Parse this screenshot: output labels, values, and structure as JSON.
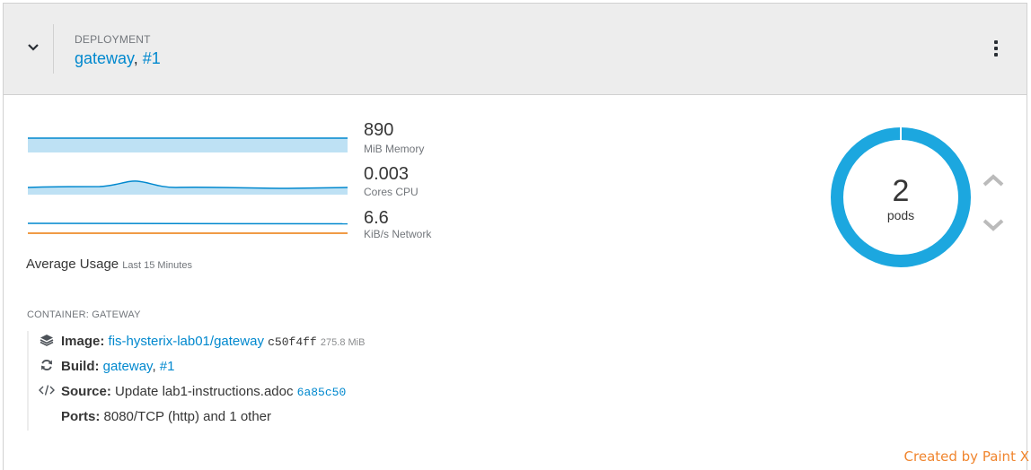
{
  "header": {
    "kind_label": "DEPLOYMENT",
    "deployment_name": "gateway",
    "separator": ",",
    "version": "#1"
  },
  "metrics": [
    {
      "value": "890",
      "unit": "MiB Memory"
    },
    {
      "value": "0.003",
      "unit": "Cores CPU"
    },
    {
      "value": "6.6",
      "unit": "KiB/s Network"
    }
  ],
  "average_usage": {
    "label": "Average Usage",
    "range": "Last 15 Minutes"
  },
  "pods": {
    "count": "2",
    "label": "pods",
    "ring_color": "#1ca7df"
  },
  "container": {
    "label": "CONTAINER: GATEWAY",
    "image": {
      "label": "Image:",
      "name": "fis-hysterix-lab01/gateway",
      "hash": "c50f4ff",
      "size": "275.8 MiB"
    },
    "build": {
      "label": "Build:",
      "name": "gateway",
      "separator": ",",
      "number": "#1"
    },
    "source": {
      "label": "Source:",
      "message": "Update lab1-instructions.adoc",
      "commit": "6a85c50"
    },
    "ports": {
      "label": "Ports:",
      "value": "8080/TCP (http) and 1 other"
    }
  },
  "credit": "Created by Paint X",
  "colors": {
    "link": "#0088ce",
    "spark_fill": "#bee1f4",
    "spark_line": "#0088ce",
    "network_sent": "#ec7a08",
    "credit": "#f0852e"
  }
}
